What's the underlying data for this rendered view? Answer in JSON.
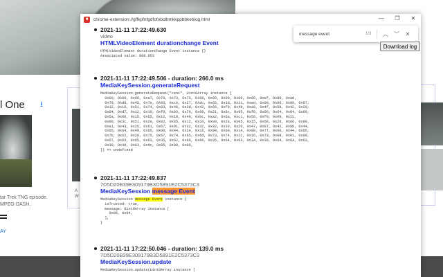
{
  "background": {
    "card_title": "l One",
    "card_text_1": "tar Trek TNG episode.",
    "card_text_2": "MPEG-DASH.",
    "card_link": "AY",
    "card2_text_1": "A",
    "card2_text_2": "W"
  },
  "window": {
    "url": "chrome-extension://gffkpfnfgdfofobolbmkkppbbkeblog.html",
    "controls": {
      "minimize": "—",
      "restore": "❐",
      "close": "✕"
    }
  },
  "find": {
    "query": "message event",
    "count": "1/3",
    "prev": "︿",
    "next": "﹀",
    "close": "✕"
  },
  "download_label": "Download log",
  "entries": [
    {
      "timestamp": "2021-11-11 17:22:49.630",
      "subtitle": "video",
      "name": "HTMLVideoElement durationchange Event",
      "code": "HTMLVideoElement durationchange Event instance {}\nAssociated value: 888.053"
    },
    {
      "timestamp": "2021-11-11 17:22:49.506 - duration: 266.0 ms",
      "name": "MediaKeySession.generateRequest",
      "code": "MediaKeySession.generateRequest(\"cenc\", Uint8Array instance [\n  0x00, 0x00, 0x00, 0xa7, 0x70, 0x73, 0x73, 0x68, 0x00, 0x00, 0x00, 0x00, 0xef, 0x80, 0xa9,\n  0x79, 0xd6, 0x45, 0x7e, 0x93, 0xc6, 0x27, 0xdc, 0x65, 0x1d, 0x21, 0xed, 0x00, 0x00, 0x00, 0x87,\n  0x12, 0x10, 0x51, 0x74, 0x03, 0x46, 0x3d, 0x42, 0x66, 0xf0, 0x4b, 0xa0, 0x4f, 0x58, 0x42, 0x20,\n  0x04, 0xd7, 0x12, 0x10, 0xf0, 0x93, 0x76, 0x98, 0x21, 0x6c, 0x95, 0xf8, 0x06, 0x64, 0x84, 0x69,\n  0x5a, 0x00, 0x15, 0x65, 0x12, 0x10, 0x40, 0xbc, 0xa2, 0x6a, 0xc1, 0x56, 0xf0, 0x09, 0x21,\n  0x00, 0x3c, 0x51, 0x2e, 0x02, 0x85, 0x12, 0x10, 0x00, 0x2a, 0x05, 0x15, 0x68, 0x26, 0x66, 0x00,\n  0xa1, 0x43, 0x26, 0x61, 0x67, 0x01, 0x32, 0x32, 0x32, 0x10, 0x26, 0x47, 0x87, 0x42, 0x80, 0x44,\n  0x65, 0x64, 0x40, 0x65, 0x00, 0x44, 0x2e, 0x16, 0x90, 0x00, 0x14, 0x00, 0x77, 0x60, 0x44, 0x65,\n  0x7b, 0x62, 0x20, 0x75, 0x57, 0x74, 0x65, 0x6d, 0x73, 0x74, 0x22, 0x16, 0x73, 0x08, 0x61, 0x00,\n  0x57, 0x63, 0x65, 0x63, 0x35, 0x62, 0x66, 0x66, 0x35, 0x64, 0x63, 0x34, 0x30, 0x64, 0x64, 0x63,\n  0x39, 0x40, 0x63, 0xdc, 0x85, 0x00, 0x00,\n]) => undefined"
    },
    {
      "timestamp": "2021-11-11 17:22:49.837",
      "subtitle": "7D5D20B39E309179B3D5891E2C5373C3",
      "name_prefix": "MediaKeySession ",
      "name_highlight": "message Event",
      "code_prefix": "MediaKeySession ",
      "code_highlight": "message Event",
      "code_suffix": " instance {\n  isTrusted: true,\n  message: Uint8Array instance [\n    0x08, 0x04,\n  ],\n}"
    },
    {
      "timestamp": "2021-11-11 17:22:50.046 - duration: 139.0 ms",
      "subtitle": "7D5D20B39E309179B3D5891E2C5373C3",
      "name": "MediaKeySession.update",
      "code": "MediaKeySession.update(Uint8Array instance ["
    }
  ]
}
